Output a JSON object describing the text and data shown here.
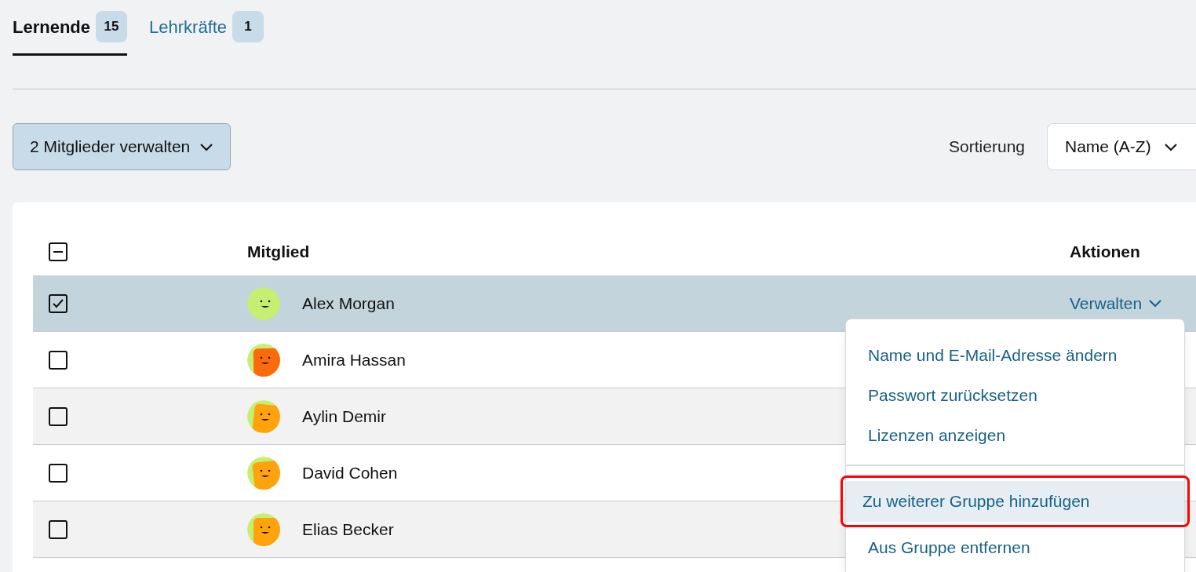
{
  "tabs": [
    {
      "label": "Lernende",
      "count": "15",
      "selected": true
    },
    {
      "label": "Lehrkräfte",
      "count": "1",
      "selected": false
    }
  ],
  "bulk_button": {
    "label": "2 Mitglieder verwalten"
  },
  "sort": {
    "label": "Sortierung",
    "value": "Name (A-Z)"
  },
  "table": {
    "select_all": {
      "indeterminate": true
    },
    "columns": [
      "Mitglied",
      "Aktionen"
    ],
    "rows": [
      {
        "name": "Alex Morgan",
        "checked": true,
        "color": "#c5ee72",
        "action": "Verwalten"
      },
      {
        "name": "Amira Hassan",
        "checked": false,
        "color": "#fb6a0b"
      },
      {
        "name": "Aylin Demir",
        "checked": false,
        "color": "#ffa30d"
      },
      {
        "name": "David Cohen",
        "checked": false,
        "color": "#ffa30d"
      },
      {
        "name": "Elias Becker",
        "checked": false,
        "color": "#ffa30d"
      }
    ]
  },
  "menu": {
    "groups": [
      [
        {
          "label": "Name und E-Mail-Adresse ändern",
          "selected": false,
          "annotated": false
        },
        {
          "label": "Passwort zurücksetzen",
          "selected": false,
          "annotated": false
        },
        {
          "label": "Lizenzen anzeigen",
          "selected": false,
          "annotated": false
        }
      ],
      [
        {
          "label": "Zu weiterer Gruppe hinzufügen",
          "selected": true,
          "annotated": true
        },
        {
          "label": "Aus Gruppe entfernen",
          "selected": false,
          "annotated": false
        }
      ]
    ]
  }
}
